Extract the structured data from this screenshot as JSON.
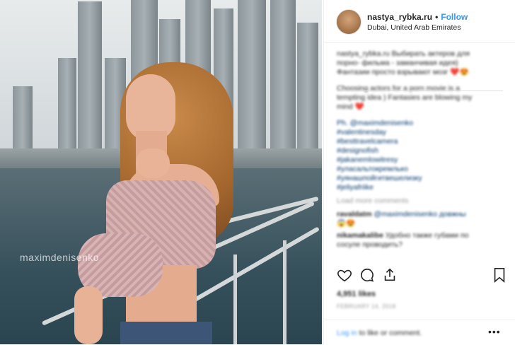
{
  "post": {
    "username": "nastya_rybka.ru",
    "separator": "•",
    "follow_label": "Follow",
    "location": "Dubai, United Arab Emirates",
    "watermark": "maximdenisenko"
  },
  "comments": {
    "caption_lines": [
      "nastya_rybka.ru Выбирать актеров для",
      "порно- фильма - заманчивая идея)",
      "Фантазии просто взрывают мозг ❤️😍"
    ],
    "translation_lines": [
      "Choosing actors for a porn movie is a",
      "tempting idea ) Fantasies are blowing my",
      "mind ❤️"
    ],
    "credit": "Ph. @maximdenisenko",
    "hashtags": [
      "#valentinesday",
      "#besttravelcamera",
      "#designofish",
      "#jakanemlowitresy",
      "#уласальтокремлько",
      "#уянашпойгитвешелизку",
      "#jeliyafriike"
    ],
    "load_more": "Load more comments",
    "reply1_user": "ravaldatm",
    "reply1_text": "@maximdenisenko довжны",
    "reply1_emoji": "😱😍",
    "reply2_user": "nikamakalibe",
    "reply2_text": "Удобно также губами по",
    "reply2_cont": "сосуле проводить?"
  },
  "actions": {
    "like_icon": "heart-icon",
    "comment_icon": "comment-icon",
    "share_icon": "share-icon",
    "save_icon": "bookmark-icon"
  },
  "likes": "4,951 likes",
  "date": "FEBRUARY 14, 2018",
  "footer": {
    "login_link": "Log in",
    "login_text": "to like or comment.",
    "more": "•••"
  },
  "colors": {
    "link": "#3897f0",
    "text": "#262626",
    "tag": "#003569",
    "heart": "#e0245e"
  }
}
